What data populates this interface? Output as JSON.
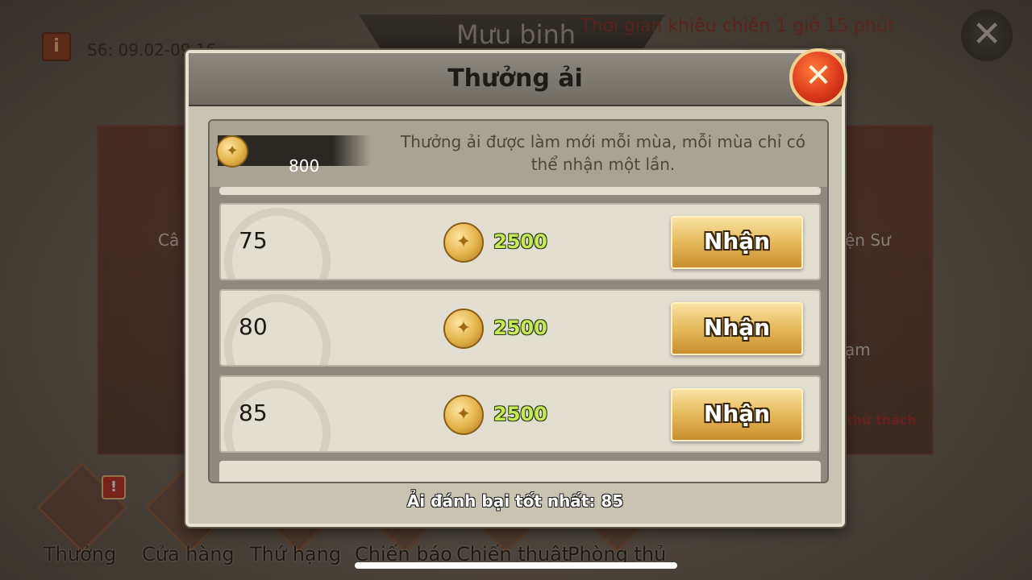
{
  "background": {
    "screen_title": "Mưu binh",
    "challenge_timer": "Thời gian khiêu chiến 1 giờ 15 phút",
    "season_label": "S6: 09.02-09.16",
    "side_left_text": "Câ",
    "side_right_text": "ện Sư",
    "side_right_text2": "ạm",
    "challenge_link": "thử thách"
  },
  "bottom_nav": {
    "items": [
      {
        "label": "Thưởng",
        "badge": "!"
      },
      {
        "label": "Cửa hàng"
      },
      {
        "label": "Thứ hạng"
      },
      {
        "label": "Chiến báo"
      },
      {
        "label": "Chiến thuật"
      },
      {
        "label": "Phòng thủ"
      }
    ]
  },
  "modal": {
    "title": "Thưởng ải",
    "close_icon": "close-x-icon",
    "currency": {
      "icon": "gold-coin-icon",
      "value": "800"
    },
    "info_text": "Thưởng ải được làm mới mỗi mùa, mỗi mùa chỉ có thể nhận một lần.",
    "rewards": [
      {
        "level": "75",
        "amount": "2500",
        "button": "Nhận"
      },
      {
        "level": "80",
        "amount": "2500",
        "button": "Nhận"
      },
      {
        "level": "85",
        "amount": "2500",
        "button": "Nhận"
      }
    ],
    "best_cleared": "Ải đánh bại tốt nhất: 85"
  },
  "colors": {
    "reward_amount": "#c7e85a",
    "close_button": "#d8361a",
    "claim_button": "#e6b95a"
  }
}
